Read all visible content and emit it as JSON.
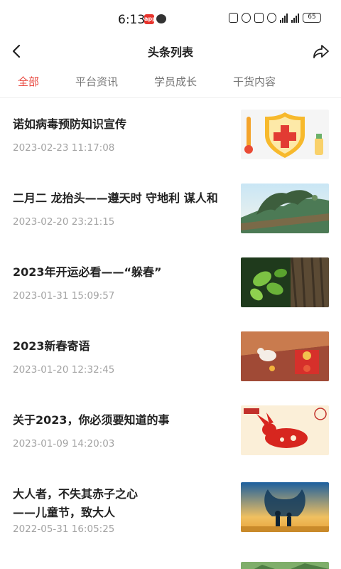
{
  "status_bar": {
    "time": "6:13",
    "battery": "65"
  },
  "header": {
    "title": "头条列表"
  },
  "tabs": [
    {
      "label": "全部",
      "active": true
    },
    {
      "label": "平台资讯",
      "active": false
    },
    {
      "label": "学员成长",
      "active": false
    },
    {
      "label": "干货内容",
      "active": false
    }
  ],
  "articles": [
    {
      "title": "诺如病毒预防知识宣传",
      "date": "2023-02-23 11:17:08",
      "thumb": "health-shield-image"
    },
    {
      "title": "二月二  龙抬头——遵天时 守地利 谋人和",
      "date": "2023-02-20 23:21:15",
      "thumb": "dragon-roof-image"
    },
    {
      "title": "2023年开运必看——“躲春”",
      "date": "2023-01-31 15:09:57",
      "thumb": "tree-leaves-image"
    },
    {
      "title": "2023新春寄语",
      "date": "2023-01-20 12:32:45",
      "thumb": "spring-festival-image"
    },
    {
      "title": "关于2023，你必须要知道的事",
      "date": "2023-01-09 14:20:03",
      "thumb": "rabbit-papercut-image"
    },
    {
      "title": "大人者，不失其赤子之心\n——儿童节，致大人",
      "date": "2022-05-31 16:05:25",
      "thumb": "childrens-day-image"
    }
  ],
  "colors": {
    "accent": "#e8453c",
    "date_text": "#a3a3a3"
  }
}
